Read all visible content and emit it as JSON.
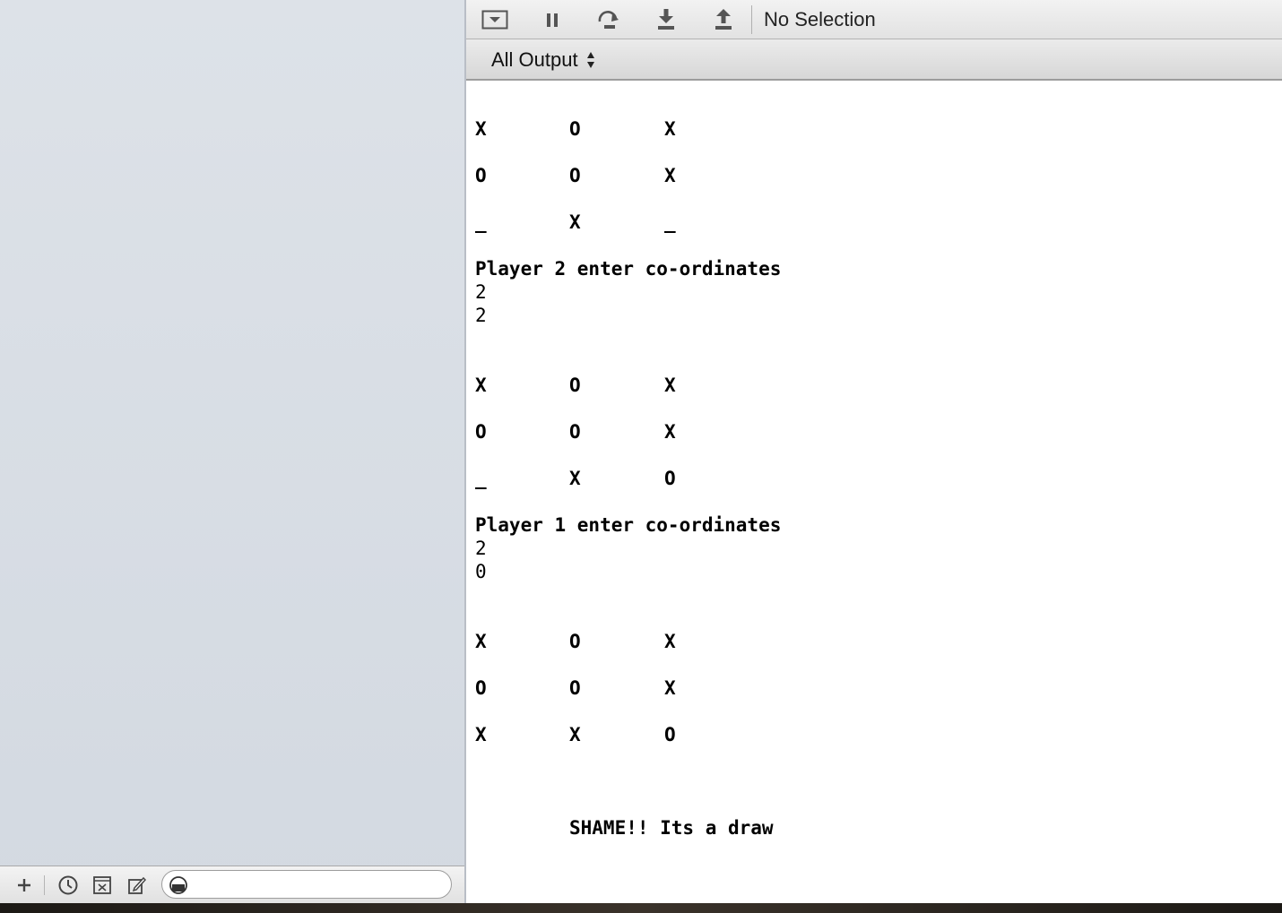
{
  "debug_bar": {
    "toggle_icon": "console-toggle-icon",
    "pause_icon": "pause-icon",
    "step_over_icon": "step-over-icon",
    "step_into_icon": "step-into-icon",
    "step_out_icon": "step-out-icon",
    "selection_label": "No Selection"
  },
  "output_bar": {
    "filter_label": "All Output"
  },
  "console_output": {
    "boards": [
      [
        [
          "X",
          "O",
          "X"
        ],
        [
          "O",
          "O",
          "X"
        ],
        [
          "_",
          "X",
          "_"
        ]
      ],
      [
        [
          "X",
          "O",
          "X"
        ],
        [
          "O",
          "O",
          "X"
        ],
        [
          "_",
          "X",
          "O"
        ]
      ],
      [
        [
          "X",
          "O",
          "X"
        ],
        [
          "O",
          "O",
          "X"
        ],
        [
          "X",
          "X",
          "O"
        ]
      ]
    ],
    "prompt_1": "Player 2 enter co-ordinates",
    "input_1a": "2",
    "input_1b": "2",
    "prompt_2": "Player 1 enter co-ordinates",
    "input_2a": "2",
    "input_2b": "0",
    "result": "SHAME!! Its a draw"
  },
  "sidebar_footer": {
    "add_icon": "plus-icon",
    "recent_icon": "clock-icon",
    "scm_icon": "scm-status-icon",
    "edited_icon": "edited-files-icon",
    "filter_icon": "filter-icon",
    "filter_value": ""
  }
}
